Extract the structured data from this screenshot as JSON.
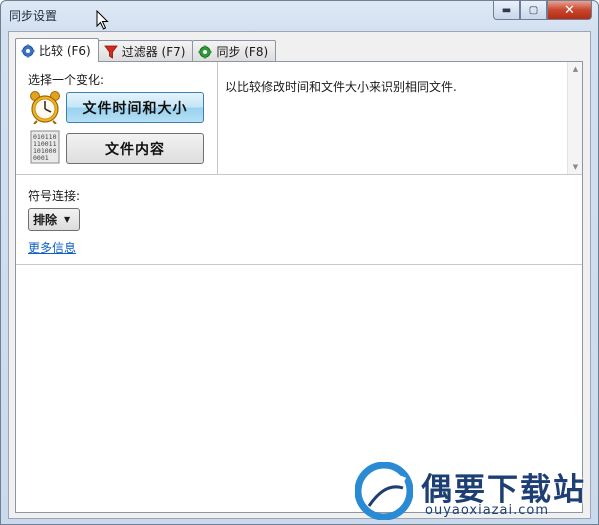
{
  "window": {
    "title": "同步设置",
    "buttons": {
      "minimize": "▬",
      "maximize": "▢",
      "close": "✕"
    }
  },
  "tabs": [
    {
      "label": "比较 (F6)",
      "icon": "gear-icon",
      "active": true
    },
    {
      "label": "过滤器 (F7)",
      "icon": "filter-icon",
      "active": false
    },
    {
      "label": "同步 (F8)",
      "icon": "gear-green-icon",
      "active": false
    }
  ],
  "compare": {
    "choose_label": "选择一个变化:",
    "options": [
      {
        "label": "文件时间和大小",
        "icon": "alarm-clock-icon",
        "selected": true
      },
      {
        "label": "文件内容",
        "icon": "binary-file-icon",
        "selected": false
      }
    ],
    "binary_lines": [
      "010110",
      "110011",
      "101000",
      "0001"
    ],
    "description": "以比较修改时间和文件大小来识别相同文件."
  },
  "symlink": {
    "label": "符号连接:",
    "value": "排除",
    "more_info": "更多信息"
  },
  "watermark": {
    "title": "偶要下载站",
    "url": "ouyaoxiazai.com"
  },
  "colors": {
    "selected_button": "#98d1ef",
    "link": "#0c5fc4",
    "close_button": "#c7462d",
    "watermark": "#1d3f73"
  }
}
